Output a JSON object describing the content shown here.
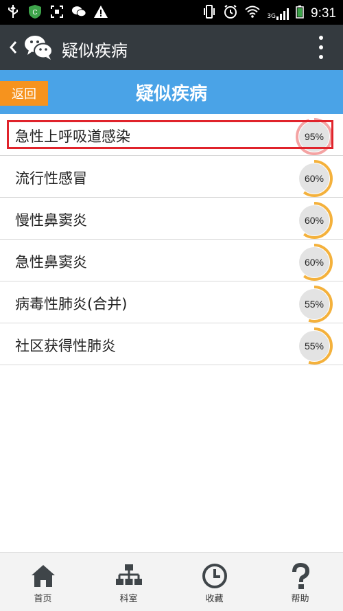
{
  "status_bar": {
    "time": "9:31",
    "network": "3G"
  },
  "action_bar": {
    "title": "疑似疾病"
  },
  "header": {
    "back_label": "返回",
    "title": "疑似疾病"
  },
  "diseases": [
    {
      "name": "急性上呼吸道感染",
      "percent": "95%",
      "value": 95,
      "color": "#f4a3a3"
    },
    {
      "name": "流行性感冒",
      "percent": "60%",
      "value": 60,
      "color": "#f4b13c"
    },
    {
      "name": "慢性鼻窦炎",
      "percent": "60%",
      "value": 60,
      "color": "#f4b13c"
    },
    {
      "name": "急性鼻窦炎",
      "percent": "60%",
      "value": 60,
      "color": "#f4b13c"
    },
    {
      "name": "病毒性肺炎(合并)",
      "percent": "55%",
      "value": 55,
      "color": "#f4b13c"
    },
    {
      "name": "社区获得性肺炎",
      "percent": "55%",
      "value": 55,
      "color": "#f4b13c"
    }
  ],
  "tabs": [
    {
      "label": "首页",
      "icon": "home-icon"
    },
    {
      "label": "科室",
      "icon": "org-chart-icon"
    },
    {
      "label": "收藏",
      "icon": "clock-icon"
    },
    {
      "label": "帮助",
      "icon": "question-icon"
    }
  ]
}
